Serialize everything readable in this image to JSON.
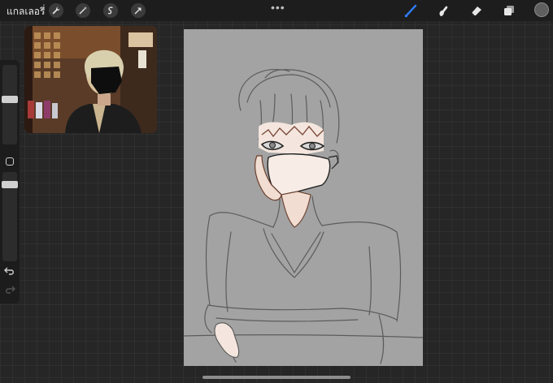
{
  "topbar": {
    "gallery_label": "แกลเลอรี่",
    "left_tools": [
      "wrench-icon",
      "magic-wand-icon",
      "selection-icon",
      "transform-arrow-icon"
    ],
    "more_label": "•••",
    "right_tools": [
      "brush-icon",
      "smudge-icon",
      "eraser-icon",
      "layers-icon"
    ],
    "active_tool": "brush-icon",
    "active_color": "#5f5f5f",
    "brush_icon_color": "#2f7bf5"
  },
  "sidebar": {
    "size_slider": 0.7,
    "opacity_slider": 0.2
  },
  "reference": {
    "visible": true
  }
}
